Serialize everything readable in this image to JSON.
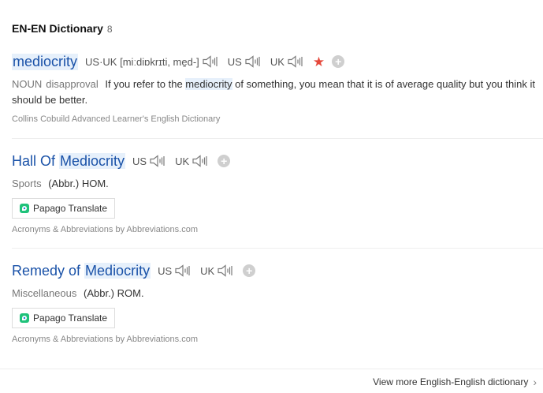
{
  "header": {
    "title": "EN-EN Dictionary",
    "count": "8"
  },
  "entries": [
    {
      "word": "mediocrity",
      "pron_us_uk": "US·UK [miːdiɒkrɪti, me̱d-]",
      "us_label": "US",
      "uk_label": "UK",
      "pos": "NOUN",
      "register": "disapproval",
      "def_before": "If you refer to the ",
      "def_highlight": "mediocrity",
      "def_after": " of something, you mean that it is of average quality but you think it should be better.",
      "source": "Collins Cobuild Advanced Learner's English Dictionary"
    },
    {
      "word_prefix": "Hall Of ",
      "word_highlight": "Mediocrity",
      "us_label": "US",
      "uk_label": "UK",
      "category": "Sports",
      "def": "(Abbr.) HOM.",
      "translate_button": "Papago Translate",
      "source": "Acronyms & Abbreviations by Abbreviations.com"
    },
    {
      "word_prefix": "Remedy of ",
      "word_highlight": "Mediocrity",
      "us_label": "US",
      "uk_label": "UK",
      "category": "Miscellaneous",
      "def": "(Abbr.) ROM.",
      "translate_button": "Papago Translate",
      "source": "Acronyms & Abbreviations by Abbreviations.com"
    }
  ],
  "footer": {
    "more_link": "View more English-English dictionary"
  },
  "icons": {
    "speaker": "speaker-icon",
    "star": "star-icon",
    "add": "add-icon",
    "papago": "papago-logo-icon",
    "chevron": "chevron-right-icon"
  },
  "colors": {
    "word": "#1a52a8",
    "highlight": "#e6f0fb",
    "star": "#e5483b"
  }
}
